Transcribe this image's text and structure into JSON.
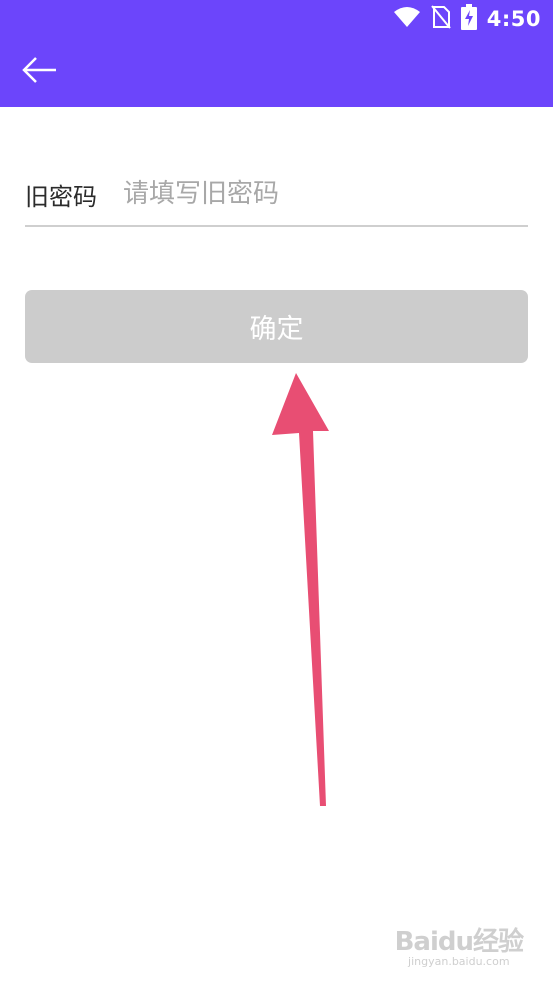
{
  "status_bar": {
    "time": "4:50",
    "icons": [
      "wifi-icon",
      "no-sim-icon",
      "battery-charging-icon"
    ]
  },
  "toolbar": {
    "back_icon": "arrow-left-icon",
    "background_color": "#6c45fb"
  },
  "form": {
    "old_password_label": "旧密码",
    "old_password_placeholder": "请填写旧密码",
    "old_password_value": ""
  },
  "confirm_button": {
    "label": "确定",
    "color": "#cccccc"
  },
  "annotation": {
    "arrow_color": "#e84e73"
  },
  "watermark": {
    "main": "Baidu经验",
    "sub": "jingyan.baidu.com"
  }
}
